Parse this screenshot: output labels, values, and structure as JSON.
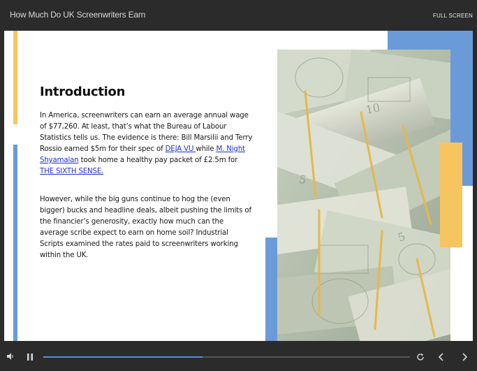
{
  "header": {
    "title": "How Much Do UK Screenwriters Earn",
    "fullscreen_label": "FULL SCREEN"
  },
  "slide": {
    "heading": "Introduction",
    "p1": {
      "t1": "In America, screenwriters can earn an average annual wage of $77,260. At least, that’s what the Bureau of Labour Statistics tells us. The evidence is there: Bill Marsilii and Terry Rossio earned $5m for their spec of ",
      "link1": "DEJA VU ",
      "t2": "while ",
      "link2": "M. Night Shyamalan",
      "t3": " took home a healthy pay packet of £2.5m for ",
      "link3": "THE SIXTH SENSE.",
      "t4": ""
    },
    "p2": "However, while the big guns continue to hog the (even bigger) bucks and headline deals, albeit pushing the limits of the financier’s generosity, exactly how much can the average scribe expect to earn on home soil? Industrial Scripts examined the rates paid to screenwriters working within the UK."
  },
  "player": {
    "progress_fraction": 0.435,
    "icons": [
      "volume-icon",
      "pause-icon",
      "replay-icon",
      "previous-icon",
      "next-icon"
    ]
  },
  "colors": {
    "accent_blue": "#6a9bd8",
    "accent_yellow": "#f7c560",
    "progress": "#5b8fd6",
    "link": "#2233cc"
  }
}
